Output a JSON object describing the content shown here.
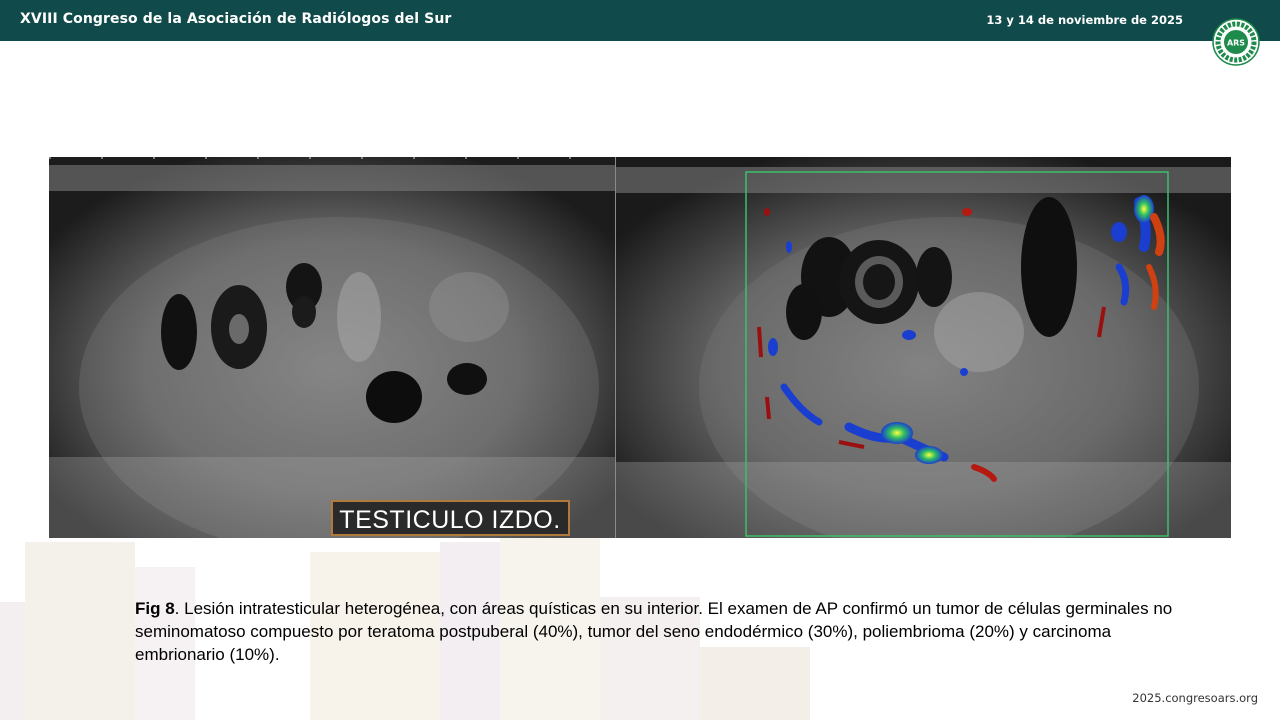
{
  "header": {
    "title": "XVIII Congreso de la Asociación de Radiólogos del Sur",
    "date": "13 y 14 de noviembre de 2025",
    "logo_text": "ARS",
    "header_color": "#114a4a"
  },
  "figure": {
    "overlay_label": "TESTICULO IZDO."
  },
  "caption": {
    "label": "Fig 8",
    "text": ". Lesión intratesticular heterogénea, con áreas quísticas en su interior. El examen de AP confirmó un tumor de células germinales no seminomatoso compuesto por teratoma postpuberal (40%), tumor del seno endodérmico (30%), poliembrioma (20%) y carcinoma embrionario (10%)."
  },
  "footer": {
    "url": "2025.congresoars.org"
  }
}
